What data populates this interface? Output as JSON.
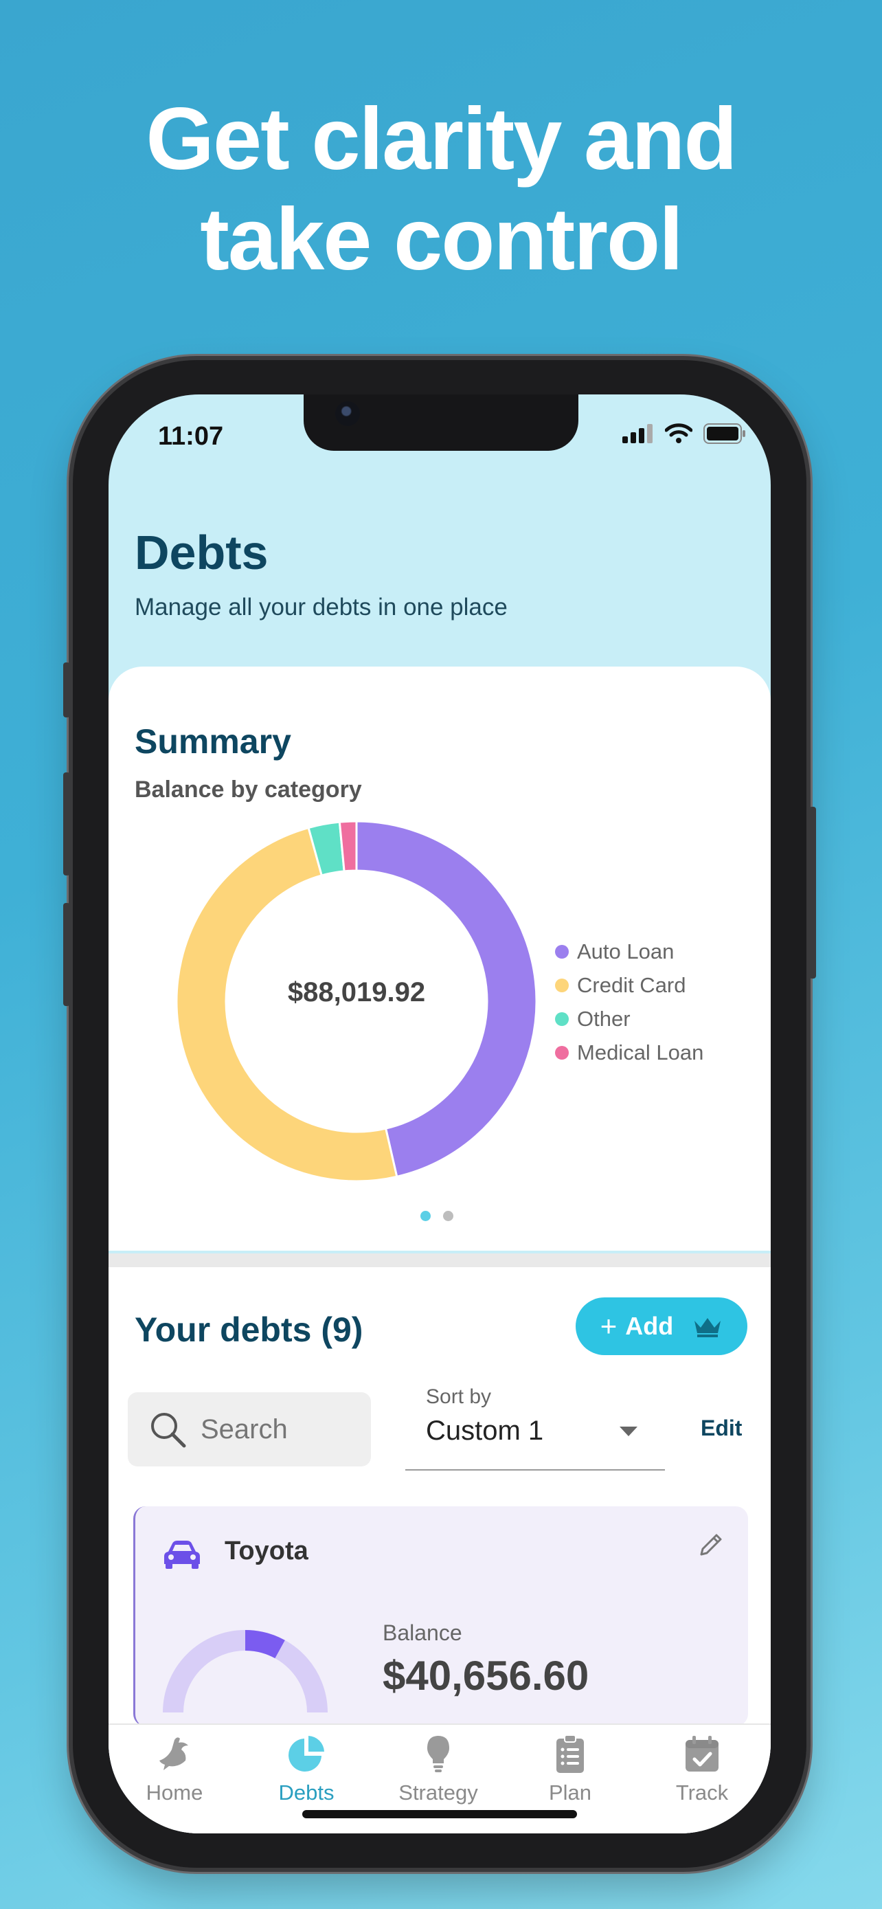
{
  "headline": {
    "line1": "Get clarity and",
    "line2": "take control"
  },
  "status_bar": {
    "time": "11:07"
  },
  "header": {
    "title": "Debts",
    "subtitle": "Manage all your debts in one place"
  },
  "summary": {
    "title": "Summary",
    "subtitle": "Balance by category",
    "total": "$88,019.92",
    "legend": [
      {
        "label": "Auto Loan",
        "color": "#9b7fee"
      },
      {
        "label": "Credit Card",
        "color": "#fdd57a"
      },
      {
        "label": "Other",
        "color": "#5fe0c6"
      },
      {
        "label": "Medical Loan",
        "color": "#ef6e9f"
      }
    ],
    "pager": {
      "pages": 2,
      "active": 1
    }
  },
  "chart_data": {
    "type": "pie",
    "variant": "donut",
    "title": "Balance by category",
    "categories": [
      "Auto Loan",
      "Credit Card",
      "Other",
      "Medical Loan"
    ],
    "values": [
      46.4,
      49.3,
      2.8,
      1.5
    ],
    "unit": "% of total (estimated)",
    "colors": [
      "#9b7fee",
      "#fdd57a",
      "#5fe0c6",
      "#ef6e9f"
    ],
    "center_label": "$88,019.92",
    "legend_position": "right"
  },
  "debts": {
    "title": "Your debts (9)",
    "add_label": "Add",
    "search_placeholder": "Search",
    "sort_label": "Sort by",
    "sort_value": "Custom 1",
    "edit_label": "Edit",
    "card": {
      "name": "Toyota",
      "balance_label": "Balance",
      "balance_value": "$40,656.60",
      "progress_paid_fraction": 0.08
    }
  },
  "tabs": [
    {
      "label": "Home",
      "icon": "dove-icon"
    },
    {
      "label": "Debts",
      "icon": "pie-chart-icon",
      "active": true
    },
    {
      "label": "Strategy",
      "icon": "lightbulb-icon"
    },
    {
      "label": "Plan",
      "icon": "clipboard-icon"
    },
    {
      "label": "Track",
      "icon": "calendar-check-icon"
    }
  ]
}
